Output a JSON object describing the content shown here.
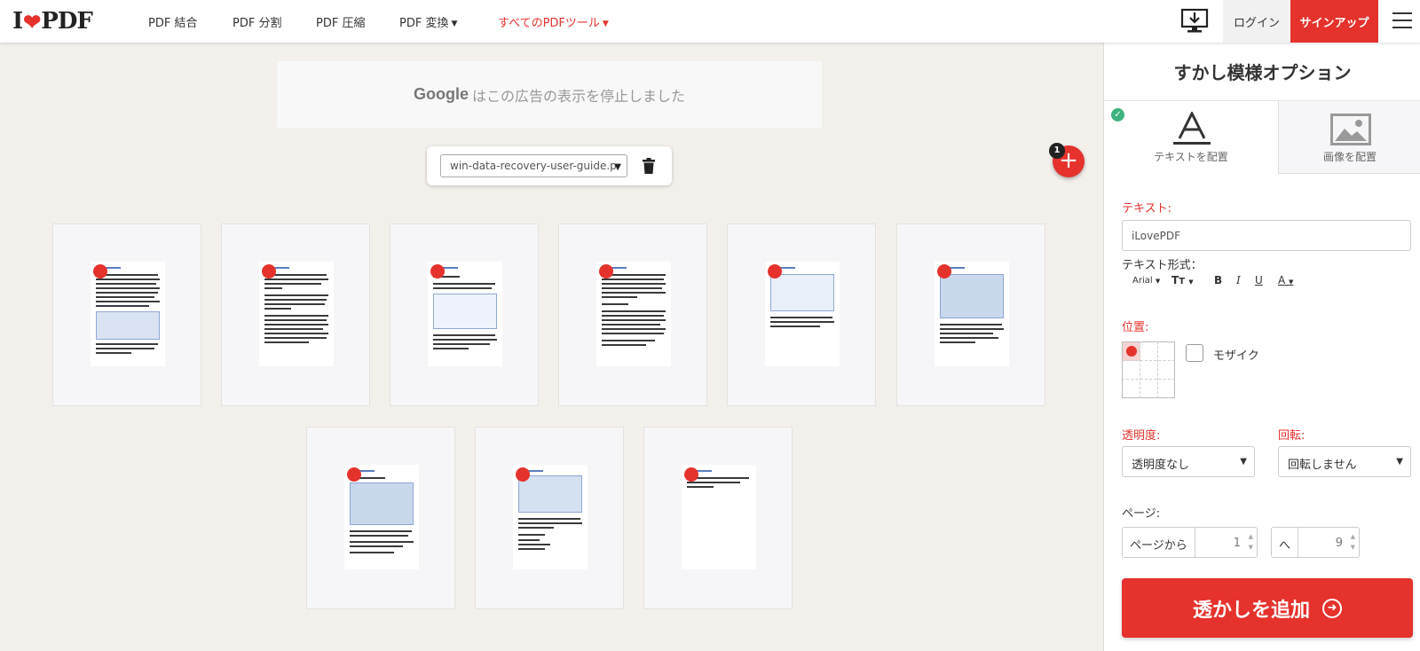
{
  "header": {
    "logo_left": "I",
    "logo_right": "PDF",
    "nav": [
      {
        "label": "PDF 結合"
      },
      {
        "label": "PDF 分割"
      },
      {
        "label": "PDF 圧縮"
      },
      {
        "label": "PDF 変換"
      },
      {
        "label": "すべてのPDFツール"
      }
    ],
    "login": "ログイン",
    "signup": "サインアップ"
  },
  "ad": {
    "brand": "Google",
    "message": "はこの広告の表示を停止しました"
  },
  "file": {
    "selected": "win-data-recovery-user-guide.p",
    "count": "1"
  },
  "sidebar": {
    "title": "すかし模様オプション",
    "tabs": [
      {
        "label": "テキストを配置"
      },
      {
        "label": "画像を配置"
      }
    ],
    "text_label": "テキスト:",
    "text_value": "iLovePDF",
    "format_label": "テキスト形式：",
    "font": "Arial",
    "position_label": "位置:",
    "mosaic_label": "モザイク",
    "transparency_label": "透明度:",
    "transparency_value": "透明度なし",
    "rotation_label": "回転:",
    "rotation_value": "回転しません",
    "pages_label": "ページ:",
    "from_label": "ページから",
    "from_value": "1",
    "to_label": "へ",
    "to_value": "9",
    "submit": "透かしを追加"
  },
  "colors": {
    "accent": "#e5322d",
    "check": "#3fb37f"
  }
}
